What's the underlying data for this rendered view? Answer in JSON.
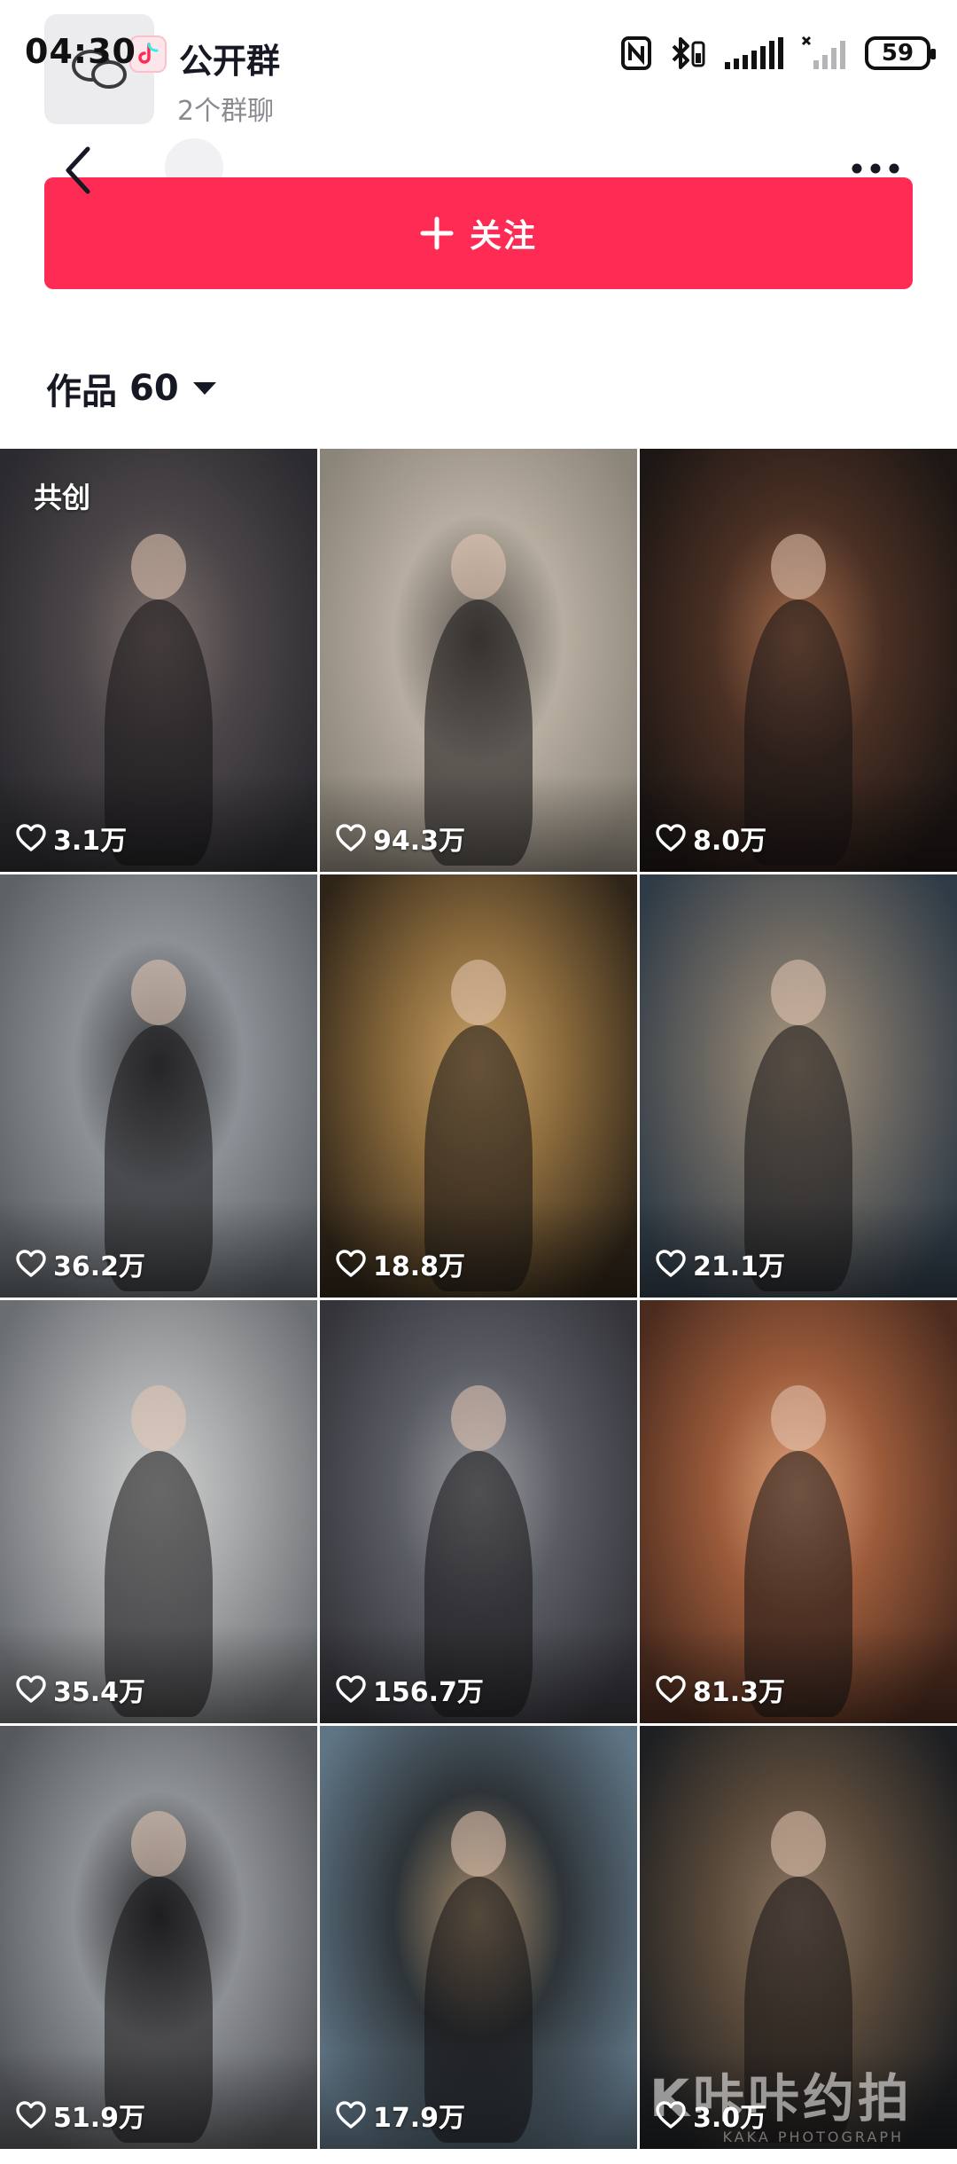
{
  "status_bar": {
    "time": "04:30",
    "battery": "59",
    "icons": [
      "nfc-icon",
      "bluetooth-icon",
      "signal-icon",
      "signal-off-icon",
      "battery-icon"
    ]
  },
  "group_card": {
    "title": "公开群",
    "subtitle": "2个群聊"
  },
  "nav": {
    "back_icon": "chevron-left-icon",
    "more_icon": "more-dots-icon"
  },
  "follow_button": {
    "label": "关注",
    "icon": "plus-icon",
    "color": "#fe2c55"
  },
  "works": {
    "title": "作品",
    "count": "60",
    "dropdown_icon": "caret-down-icon"
  },
  "grid": [
    {
      "likes": "3.1万",
      "tag": "共创",
      "palette": [
        "#2b2a2e",
        "#4a4548",
        "#7c6f6a"
      ]
    },
    {
      "likes": "94.3万",
      "tag": "",
      "palette": [
        "#8b8478",
        "#b7ada0",
        "#5e5953"
      ]
    },
    {
      "likes": "8.0万",
      "tag": "",
      "palette": [
        "#1c1614",
        "#4a3024",
        "#a36b4a"
      ]
    },
    {
      "likes": "36.2万",
      "tag": "",
      "palette": [
        "#5d6266",
        "#8c9196",
        "#3c3c3e"
      ]
    },
    {
      "likes": "18.8万",
      "tag": "",
      "palette": [
        "#2e2418",
        "#8a6a3c",
        "#c9a066"
      ]
    },
    {
      "likes": "21.1万",
      "tag": "",
      "palette": [
        "#2f3b46",
        "#6f6a63",
        "#a8957d"
      ]
    },
    {
      "likes": "35.4万",
      "tag": "",
      "palette": [
        "#6b6e71",
        "#a4a6a8",
        "#d0d0cf"
      ]
    },
    {
      "likes": "156.7万",
      "tag": "",
      "palette": [
        "#34343a",
        "#5a5c63",
        "#9a9ba0"
      ]
    },
    {
      "likes": "81.3万",
      "tag": "",
      "palette": [
        "#4a2b1e",
        "#9a5a3a",
        "#e0a27a"
      ]
    },
    {
      "likes": "51.9万",
      "tag": "",
      "palette": [
        "#55585c",
        "#8d9094",
        "#2a2a2c"
      ]
    },
    {
      "likes": "17.9万",
      "tag": "",
      "palette": [
        "#5f7585",
        "#2e3438",
        "#a48a6a"
      ]
    },
    {
      "likes": "3.0万",
      "tag": "",
      "palette": [
        "#1d1f22",
        "#5a4a3a",
        "#8c7663"
      ]
    }
  ],
  "watermark": {
    "text": "K咔咔约拍",
    "sub": "KAKA PHOTOGRAPH"
  }
}
